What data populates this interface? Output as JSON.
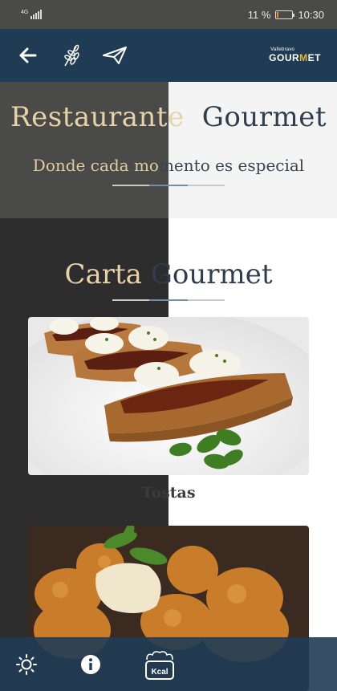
{
  "status": {
    "network": "4G",
    "battery": "11 %",
    "battery_level": 0.11,
    "time": "10:30"
  },
  "header": {
    "back_icon": "arrow-left-icon",
    "wheat_icon": "wheat-icon",
    "send_icon": "paper-plane-icon",
    "logo_small": "Vallebravo",
    "logo_big_a": "GOUR",
    "logo_big_m": "M",
    "logo_big_b": "ET"
  },
  "hero": {
    "title_part1": "Restaurante",
    "title_part2": "Gourmet",
    "subtitle_part1": "Donde cada mo",
    "subtitle_part2": "mento es especial"
  },
  "menu": {
    "section_part1": "Carta ",
    "section_part2": "Gourmet",
    "items": [
      {
        "caption": "Tostas"
      }
    ]
  },
  "bottom": {
    "brightness_icon": "sun-icon",
    "info_icon": "info-icon",
    "kcal_label": "Kcal"
  },
  "colors": {
    "header": "#203c55",
    "accent": "#e8d2a8",
    "rule": "#6f8fab"
  }
}
